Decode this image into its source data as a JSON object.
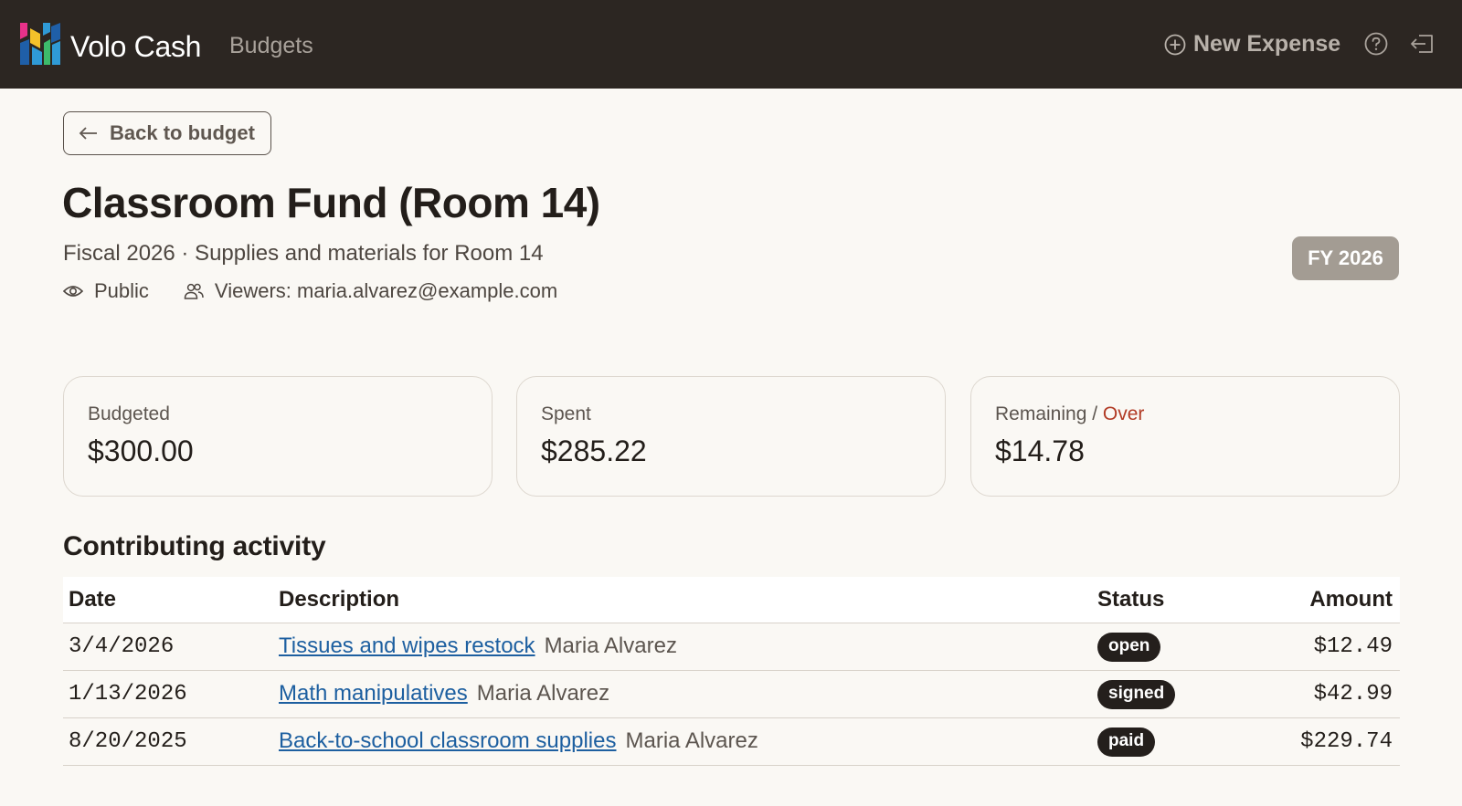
{
  "header": {
    "brand": "Volo Cash",
    "nav_budgets": "Budgets",
    "new_expense": "New Expense",
    "logo_colors": [
      "#e8318a",
      "#f4c12a",
      "#2f9ad6",
      "#3dbb6b",
      "#1f5fa8"
    ]
  },
  "page": {
    "back_label": "Back to budget",
    "title": "Classroom Fund (Room 14)",
    "subtitle": "Fiscal 2026 · Supplies and materials for Room 14",
    "visibility": "Public",
    "viewers": "Viewers: maria.alvarez@example.com",
    "fy_badge": "FY 2026"
  },
  "summary": {
    "budgeted_label": "Budgeted",
    "budgeted_value": "$300.00",
    "spent_label": "Spent",
    "spent_value": "$285.22",
    "remaining_label": "Remaining",
    "remaining_separator": " / ",
    "over_label": "Over",
    "remaining_value": "$14.78",
    "over_color": "#b13a24"
  },
  "activity": {
    "section_title": "Contributing activity",
    "columns": [
      "Date",
      "Description",
      "Status",
      "Amount"
    ],
    "rows": [
      {
        "date": "3/4/2026",
        "description": "Tissues and wipes restock",
        "owner": "Maria Alvarez",
        "status": "open",
        "amount": "$12.49"
      },
      {
        "date": "1/13/2026",
        "description": "Math manipulatives",
        "owner": "Maria Alvarez",
        "status": "signed",
        "amount": "$42.99"
      },
      {
        "date": "8/20/2025",
        "description": "Back-to-school classroom supplies",
        "owner": "Maria Alvarez",
        "status": "paid",
        "amount": "$229.74"
      }
    ]
  }
}
